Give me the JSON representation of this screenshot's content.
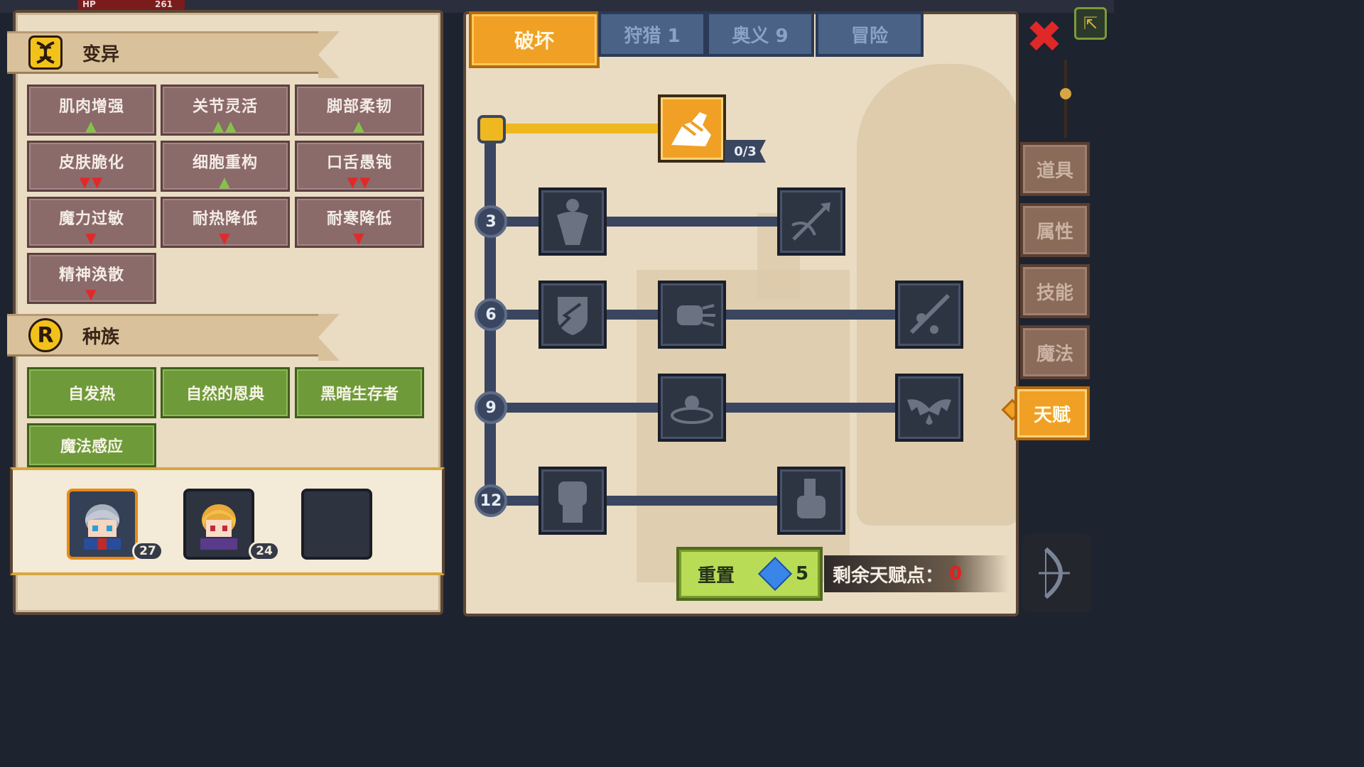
{
  "hud": {
    "hp_label": "HP",
    "hp_value": "261"
  },
  "left": {
    "mutation": {
      "title": "变异",
      "icon": "dna-icon",
      "items": [
        {
          "label": "肌肉增强",
          "arrows": "▲",
          "kind": "up"
        },
        {
          "label": "关节灵活",
          "arrows": "▲▲",
          "kind": "up"
        },
        {
          "label": "脚部柔韧",
          "arrows": "▲",
          "kind": "up"
        },
        {
          "label": "皮肤脆化",
          "arrows": "▼▼",
          "kind": "down"
        },
        {
          "label": "细胞重构",
          "arrows": "▲",
          "kind": "up"
        },
        {
          "label": "口舌愚钝",
          "arrows": "▼▼",
          "kind": "down"
        },
        {
          "label": "魔力过敏",
          "arrows": "▼",
          "kind": "down"
        },
        {
          "label": "耐热降低",
          "arrows": "▼",
          "kind": "down"
        },
        {
          "label": "耐寒降低",
          "arrows": "▼",
          "kind": "down"
        },
        {
          "label": "精神涣散",
          "arrows": "▼",
          "kind": "down"
        }
      ]
    },
    "race": {
      "title": "种族",
      "icon_letter": "R",
      "items": [
        "自发热",
        "自然的恩典",
        "黑暗生存者",
        "魔法感应"
      ]
    },
    "party": {
      "members": [
        {
          "level": "27",
          "selected": true
        },
        {
          "level": "24",
          "selected": false
        }
      ]
    }
  },
  "right": {
    "tabs": {
      "active": "破坏",
      "hunt": "狩猎 1",
      "mystery": "奥义 9",
      "adventure": "冒险"
    },
    "tree": {
      "tiers": [
        "3",
        "6",
        "9",
        "12"
      ],
      "top_skill_count": "0/3"
    },
    "reset": {
      "label": "重置",
      "gem_cost": "5"
    },
    "points": {
      "label": "剩余天赋点：",
      "value": "0"
    }
  },
  "side": {
    "tabs": [
      "道具",
      "属性",
      "技能",
      "魔法",
      "天赋"
    ],
    "active": "天赋"
  },
  "colors": {
    "accent": "#f0a024",
    "panel": "#e9dcc3",
    "mutation_tile": "#8b6a6a",
    "race_tile": "#6e9a3a",
    "up_arrow": "#86c24a",
    "down_arrow": "#e02a2a",
    "points_value": "#e42020"
  }
}
